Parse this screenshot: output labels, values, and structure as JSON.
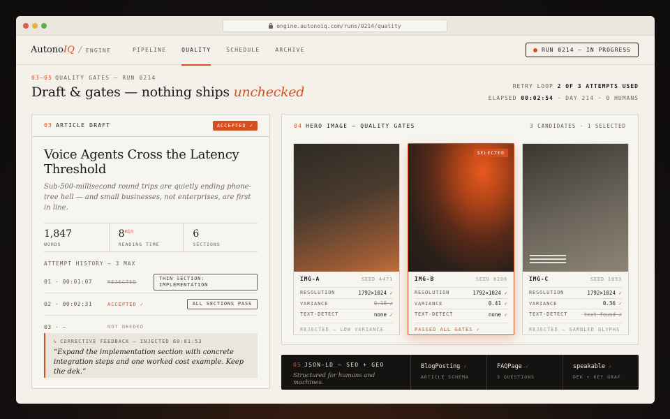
{
  "browser": {
    "url": "engine.autonoiq.com/runs/0214/quality"
  },
  "brand": {
    "name_a": "Autono",
    "name_b": "IQ",
    "sep": "/",
    "sub": "ENGINE"
  },
  "nav": [
    {
      "label": "PIPELINE"
    },
    {
      "label": "QUALITY"
    },
    {
      "label": "SCHEDULE"
    },
    {
      "label": "ARCHIVE"
    }
  ],
  "run_status": "RUN 0214 — IN PROGRESS",
  "header": {
    "step": "03–05",
    "eyebrow": "QUALITY GATES — RUN 0214",
    "title_a": "Draft & gates — nothing ships ",
    "title_em": "unchecked",
    "retry_a": "RETRY LOOP ",
    "retry_b": "2 OF 3 ATTEMPTS USED",
    "elapsed_a": "ELAPSED ",
    "elapsed_b": "00:02:54",
    "elapsed_c": " · DAY 214 · 0 HUMANS"
  },
  "article": {
    "num": "03",
    "label": "ARTICLE DRAFT",
    "status": "ACCEPTED ✓",
    "title": "Voice Agents Cross the Latency Threshold",
    "dek": "Sub-500-millisecond round trips are quietly ending phone-tree hell — and small businesses, not enterprises, are first in line.",
    "stats": [
      {
        "value": "1,847",
        "sup": "",
        "label": "WORDS"
      },
      {
        "value": "8",
        "sup": "min",
        "label": "READING TIME"
      },
      {
        "value": "6",
        "sup": "",
        "label": "SECTIONS"
      }
    ],
    "attempt_heading": "ATTEMPT HISTORY — 3 MAX",
    "attempts": [
      {
        "time": "01 · 00:01:07",
        "status": "REJECTED",
        "note": "THIN SECTION: IMPLEMENTATION"
      },
      {
        "time": "02 · 00:02:31",
        "status": "ACCEPTED ✓",
        "note": "ALL SECTIONS PASS"
      },
      {
        "time": "03 · —",
        "status": "NOT NEEDED",
        "note": ""
      }
    ],
    "feedback": {
      "icon": "↳",
      "heading": "CORRECTIVE FEEDBACK — INJECTED 00:01:53",
      "quote": "“Expand the implementation section with concrete integration steps and one worked cost example. Keep the dek.”"
    }
  },
  "hero": {
    "num": "04",
    "label": "HERO IMAGE — QUALITY GATES",
    "meta": "3 CANDIDATES · 1 SELECTED",
    "candidates": [
      {
        "id": "IMG-A",
        "seed": "SEED 4471",
        "resolution": "1792×1024",
        "variance": "0.18",
        "text_detect": "none",
        "status": "REJECTED — LOW VARIANCE"
      },
      {
        "id": "IMG-B",
        "seed": "SEED 8206",
        "resolution": "1792×1024",
        "variance": "0.41",
        "text_detect": "none",
        "status": "PASSED ALL GATES ✓",
        "chip": "SELECTED"
      },
      {
        "id": "IMG-C",
        "seed": "SEED 1093",
        "resolution": "1792×1024",
        "variance": "0.36",
        "text_detect": "text found",
        "status": "REJECTED — GARBLED GLYPHS"
      }
    ],
    "row_labels": {
      "resolution": "RESOLUTION",
      "variance": "VARIANCE",
      "text_detect": "TEXT-DETECT"
    },
    "check": "✓",
    "cross": "✗"
  },
  "schema": {
    "num": "05",
    "label": "JSON-LD — SEO + GEO",
    "sub": "Structured for humans and machines.",
    "items": [
      {
        "title": "BlogPosting",
        "sub": "ARTICLE SCHEMA"
      },
      {
        "title": "FAQPage",
        "sub": "3 QUESTIONS"
      },
      {
        "title": "speakable",
        "sub": "DEK + KEY GRAF"
      }
    ]
  },
  "colors": {
    "accent": "#d94e1f",
    "page": "#f4f1ea",
    "dark": "#151312"
  }
}
